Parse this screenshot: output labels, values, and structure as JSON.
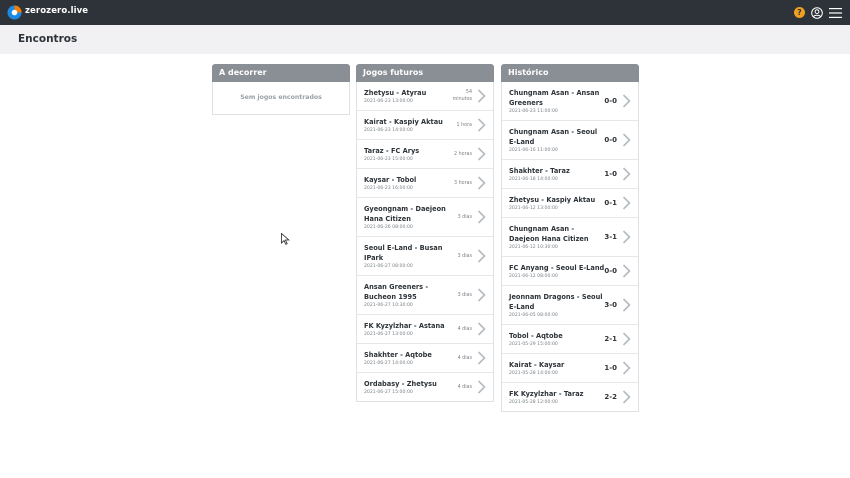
{
  "app": {
    "brand": "zerozero.live"
  },
  "page": {
    "title": "Encontros"
  },
  "columns": {
    "live": {
      "title": "A decorrer",
      "empty": "Sem jogos encontrados"
    },
    "upcoming": {
      "title": "Jogos futuros",
      "items": [
        {
          "match": "Zhetysu - Atyrau",
          "date": "2021-06-23 13:00:00",
          "eta": "54 minutos"
        },
        {
          "match": "Kairat - Kaspiy Aktau",
          "date": "2021-06-23 14:00:00",
          "eta": "1 hora"
        },
        {
          "match": "Taraz - FC Arys",
          "date": "2021-06-23 15:00:00",
          "eta": "2 horas"
        },
        {
          "match": "Kaysar - Tobol",
          "date": "2021-06-23 16:00:00",
          "eta": "3 horas"
        },
        {
          "match": "Gyeongnam - Daejeon Hana Citizen",
          "date": "2021-06-26 08:00:00",
          "eta": "3 dias"
        },
        {
          "match": "Seoul E-Land - Busan IPark",
          "date": "2021-06-27 08:00:00",
          "eta": "3 dias"
        },
        {
          "match": "Ansan Greeners - Bucheon 1995",
          "date": "2021-06-27 10:30:00",
          "eta": "3 dias"
        },
        {
          "match": "FK Kyzylzhar - Astana",
          "date": "2021-06-27 13:00:00",
          "eta": "4 dias"
        },
        {
          "match": "Shakhter - Aqtobe",
          "date": "2021-06-27 14:00:00",
          "eta": "4 dias"
        },
        {
          "match": "Ordabasy - Zhetysu",
          "date": "2021-06-27 15:00:00",
          "eta": "4 dias"
        }
      ]
    },
    "history": {
      "title": "Histórico",
      "items": [
        {
          "match": "Chungnam Asan - Ansan Greeners",
          "date": "2021-06-23 11:00:00",
          "score": "0-0"
        },
        {
          "match": "Chungnam Asan - Seoul E-Land",
          "date": "2021-06-16 11:00:00",
          "score": "0-0"
        },
        {
          "match": "Shakhter - Taraz",
          "date": "2021-06-18 14:00:00",
          "score": "1-0"
        },
        {
          "match": "Zhetysu - Kaspiy Aktau",
          "date": "2021-06-12 13:00:00",
          "score": "0-1"
        },
        {
          "match": "Chungnam Asan - Daejeon Hana Citizen",
          "date": "2021-06-12 10:30:00",
          "score": "3-1"
        },
        {
          "match": "FC Anyang - Seoul E-Land",
          "date": "2021-06-12 08:00:00",
          "score": "0-0"
        },
        {
          "match": "Jeonnam Dragons - Seoul E-Land",
          "date": "2021-06-05 08:00:00",
          "score": "3-0"
        },
        {
          "match": "Tobol - Aqtobe",
          "date": "2021-05-29 15:00:00",
          "score": "2-1"
        },
        {
          "match": "Kairat - Kaysar",
          "date": "2021-05-28 14:00:00",
          "score": "1-0"
        },
        {
          "match": "FK Kyzylzhar - Taraz",
          "date": "2021-05-28 12:00:00",
          "score": "2-2"
        }
      ]
    }
  },
  "icons": {
    "logo": "zerozero-logo-icon",
    "help": "help-icon",
    "account": "account-icon",
    "menu": "hamburger-menu-icon",
    "row": "chevron-right-icon"
  },
  "colors": {
    "topbar": "#2d3338",
    "accent": "#f0a020",
    "column_header": "#8a8f95"
  }
}
